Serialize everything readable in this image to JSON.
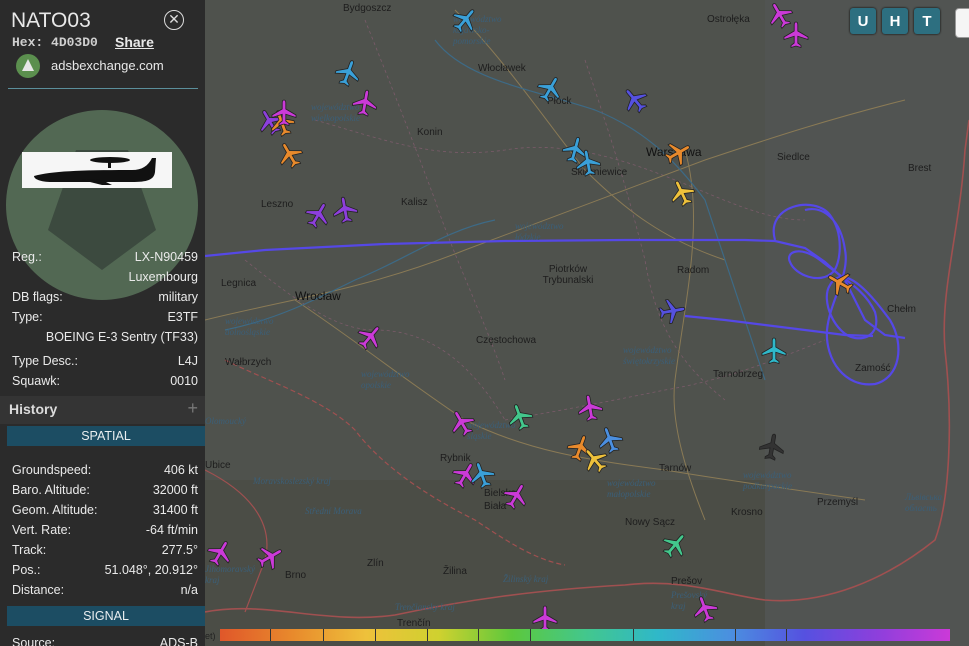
{
  "aircraft": {
    "callsign": "NATO03",
    "hex_label": "Hex:",
    "hex": "4D03D0",
    "share_label": "Share",
    "source_site": "adsbexchange.com",
    "reg_label": "Reg.:",
    "reg": "LX-N90459",
    "country": "Luxembourg",
    "dbflags_label": "DB flags:",
    "dbflags": "military",
    "type_label": "Type:",
    "type": "E3TF",
    "type_full": "BOEING E-3 Sentry (TF33)",
    "typedesc_label": "Type Desc.:",
    "typedesc": "L4J",
    "squawk_label": "Squawk:",
    "squawk": "0010"
  },
  "history": {
    "title": "History",
    "plus": "+"
  },
  "spatial": {
    "title": "SPATIAL",
    "groundspeed_label": "Groundspeed:",
    "groundspeed": "406 kt",
    "baro_label": "Baro. Altitude:",
    "baro": "32000 ft",
    "geom_label": "Geom. Altitude:",
    "geom": "31400 ft",
    "vrate_label": "Vert. Rate:",
    "vrate": "-64 ft/min",
    "track_label": "Track:",
    "track": "277.5°",
    "pos_label": "Pos.:",
    "pos": "51.048°, 20.912°",
    "dist_label": "Distance:",
    "dist": "n/a"
  },
  "signal": {
    "title": "SIGNAL",
    "source_label": "Source:",
    "source": "ADS-B"
  },
  "map_buttons": [
    "U",
    "H",
    "T"
  ],
  "legend": {
    "label": "et)"
  },
  "colors": {
    "panel_bg": "#2b2b2b",
    "section_bar": "#1c4d63",
    "map_btn": "#2d6f80",
    "track": "#5548e6"
  },
  "map": {
    "cities": [
      {
        "name": "Bydgoszcz",
        "big": false
      },
      {
        "name": "Ostrołęka",
        "big": false
      },
      {
        "name": "Włocławek",
        "big": false
      },
      {
        "name": "Płock",
        "big": false
      },
      {
        "name": "Konin",
        "big": false
      },
      {
        "name": "Warszawa",
        "big": true
      },
      {
        "name": "Siedlce",
        "big": false
      },
      {
        "name": "Skierniewice",
        "big": false
      },
      {
        "name": "Leszno",
        "big": false
      },
      {
        "name": "Kalisz",
        "big": false
      },
      {
        "name": "Brest",
        "big": false
      },
      {
        "name": "Piotrków Trybunalski",
        "big": false
      },
      {
        "name": "Radom",
        "big": false
      },
      {
        "name": "Legnica",
        "big": false
      },
      {
        "name": "Wrocław",
        "big": true
      },
      {
        "name": "Chełm",
        "big": false
      },
      {
        "name": "Częstochowa",
        "big": false
      },
      {
        "name": "Wałbrzych",
        "big": false
      },
      {
        "name": "Tarnobrzeg",
        "big": false
      },
      {
        "name": "Zamość",
        "big": false
      },
      {
        "name": "Rybnik",
        "big": false
      },
      {
        "name": "Tarnów",
        "big": false
      },
      {
        "name": "Bielsko-Biała",
        "big": false
      },
      {
        "name": "Przemyśl",
        "big": false
      },
      {
        "name": "Krosno",
        "big": false
      },
      {
        "name": "Nowy Sącz",
        "big": false
      },
      {
        "name": "Brno",
        "big": false
      },
      {
        "name": "Zlín",
        "big": false
      },
      {
        "name": "Žilina",
        "big": false
      },
      {
        "name": "Prešov",
        "big": false
      },
      {
        "name": "Trenčín",
        "big": false
      },
      {
        "name": "Ubice",
        "big": false
      }
    ],
    "regions": [
      "województwo kujawsko-pomorskie",
      "województwo wielkopolskie",
      "województwo łódzkie",
      "województwo dolnośląskie",
      "województwo opolskie",
      "województwo świętokrzyskie",
      "województwo śląskie",
      "województwo małopolskie",
      "województwo podkarpackie",
      "Moravskoslezský kraj",
      "Střední Morava",
      "Jihomoravský kraj",
      "Žilinský kraj",
      "Prešovský kraj",
      "Trenčiansky kraj",
      "Львівська область",
      "Olomoucký"
    ],
    "aircraft_icons": [
      {
        "name": "plane-icon",
        "color": "#3aa0d8"
      },
      {
        "name": "plane-icon",
        "color": "#cb3ad8"
      },
      {
        "name": "plane-icon",
        "color": "#3aa0d8"
      },
      {
        "name": "plane-icon",
        "color": "#5551e0"
      },
      {
        "name": "plane-icon",
        "color": "#e88a2c"
      },
      {
        "name": "plane-icon",
        "color": "#eec13b"
      },
      {
        "name": "plane-icon",
        "color": "#8d3fdc"
      },
      {
        "name": "selected-plane-icon",
        "color": "#5551e0"
      },
      {
        "name": "plane-icon",
        "color": "#e88a2c"
      },
      {
        "name": "plane-icon",
        "color": "#3aa0d8"
      },
      {
        "name": "plane-icon",
        "color": "#333333"
      },
      {
        "name": "plane-icon",
        "color": "#43c78c"
      }
    ]
  }
}
